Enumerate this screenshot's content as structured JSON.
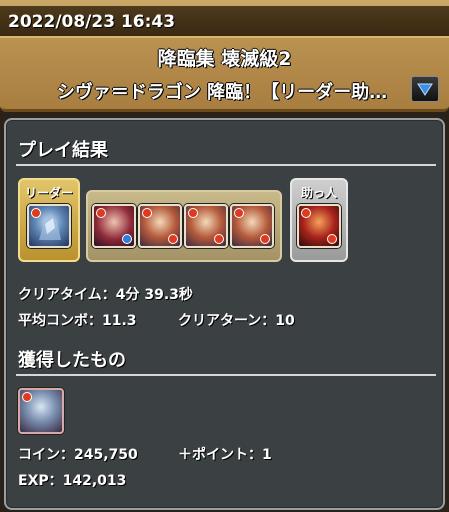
{
  "header": {
    "timestamp": "2022/08/23 16:43",
    "dungeon_title": "降臨集 壊滅級2",
    "dungeon_subtitle": "シヴァ＝ドラゴン 降臨！【リーダー助…"
  },
  "results": {
    "section_title": "プレイ結果",
    "leader_label": "リーダー",
    "helper_label": "助っ人",
    "clear_time": "クリアタイム：4分 39.3秒",
    "avg_combo": "平均コンボ：11.3",
    "clear_turns": "クリアターン：10"
  },
  "obtained": {
    "section_title": "獲得したもの",
    "coins": "コイン：245,750",
    "points": "＋ポイント：1",
    "exp": "EXP：142,013"
  },
  "colors": {
    "fire": "#e2381c",
    "water": "#2a7fe0",
    "header_gold": "#b8904f"
  }
}
